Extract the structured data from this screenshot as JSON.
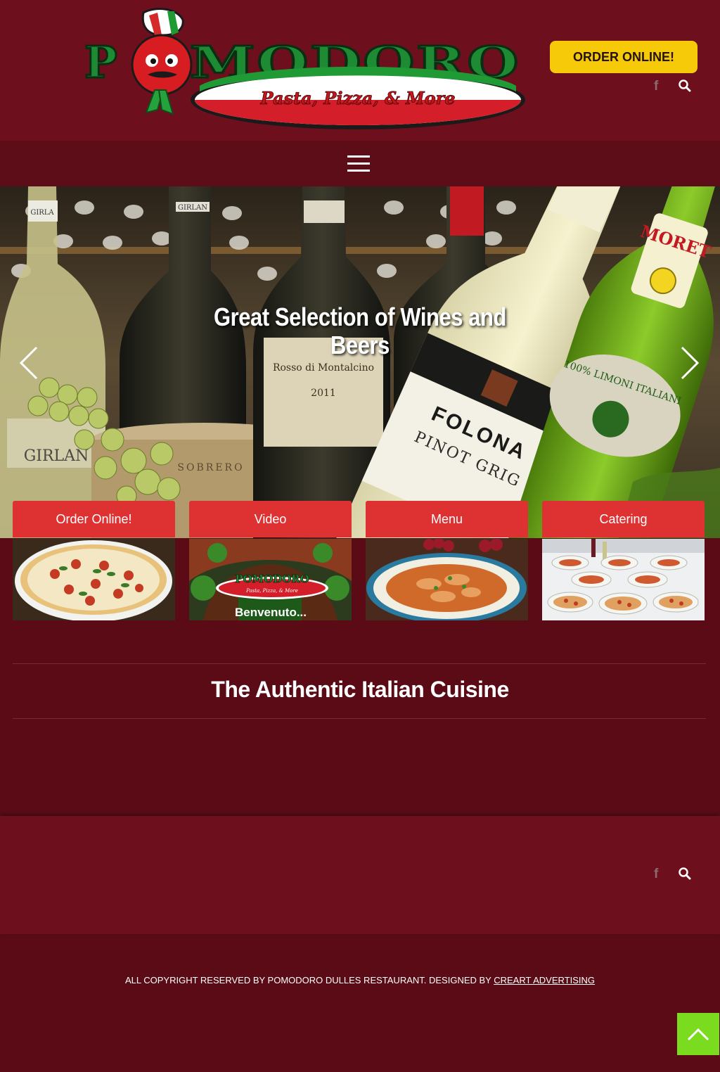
{
  "header": {
    "logo": {
      "wordmark": "POMODORO",
      "tagline": "Pasta, Pizza, & More"
    },
    "order_button": "ORDER ONLINE!",
    "facebook_glyph": "f"
  },
  "hero": {
    "title": "Great Selection of Wines and Beers",
    "photo_labels": {
      "bottle_a": "GIRLAN",
      "bottle_b": "Rosso di Montalcino",
      "bottle_c_year": "2011",
      "bottle_d": "FOLONA",
      "bottle_d_sub": "PINOT GRIG",
      "beer": "MORET",
      "beer_sub": "100% LIMONI ITALIANI",
      "cheese": "SOBRERO"
    }
  },
  "tiles": [
    {
      "label": "Order Online!",
      "image": "pizza-photo"
    },
    {
      "label": "Video",
      "image": "restaurant-interior-photo",
      "overlay": "Benvenuto..."
    },
    {
      "label": "Menu",
      "image": "pasta-dish-photo"
    },
    {
      "label": "Catering",
      "image": "catering-table-photo"
    }
  ],
  "section": {
    "title": "The Authentic Italian Cuisine"
  },
  "footer": {
    "facebook_glyph": "f",
    "copyright_text": "ALL COPYRIGHT RESERVED BY POMODORO DULLES RESTAURANT. DESIGNED BY ",
    "designer_link": "CREART ADVERTISING"
  },
  "colors": {
    "background": "#5a0b16",
    "header": "#6e0f1d",
    "order_button": "#f6c909",
    "tile_label": "#de3132",
    "back_to_top": "#7bdb1f"
  }
}
